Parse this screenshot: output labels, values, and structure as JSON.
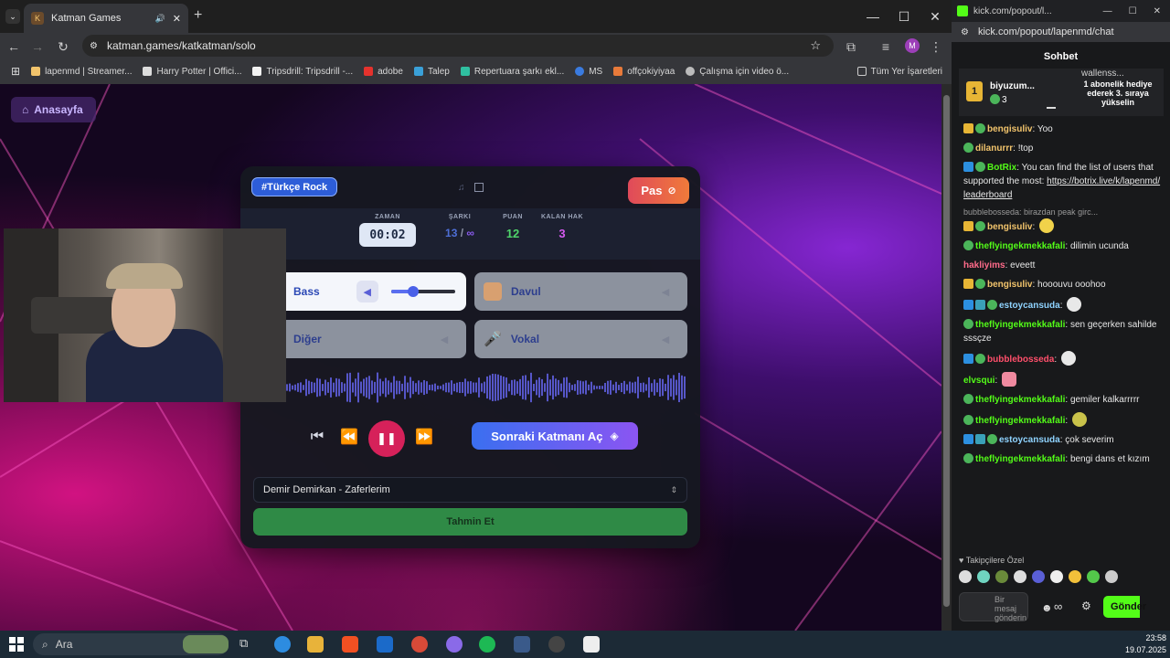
{
  "browser": {
    "tab_title": "Katman Games",
    "url": "katman.games/katkatman/solo",
    "bookmarks": [
      "lapenmd | Streamer...",
      "Harry Potter | Offici...",
      "Tripsdrill: Tripsdrill -...",
      "adobe",
      "Talep",
      "Repertuara şarkı ekl...",
      "MS",
      "offçokiyiyaa",
      "Çalışma için video ö..."
    ],
    "all_bookmarks": "Tüm Yer İşaretleri"
  },
  "page": {
    "home_label": "Anasayfa",
    "genre_tag": "#Türkçe Rock",
    "pass_label": "Pas",
    "stats": {
      "time_label": "ZAMAN",
      "time_value": "00:02",
      "song_label": "ŞARKI",
      "song_current": "13",
      "song_sep": "/",
      "song_total": "∞",
      "score_label": "PUAN",
      "score_value": "12",
      "lives_label": "KALAN HAK",
      "lives_value": "3"
    },
    "layers": [
      {
        "label": "Bass",
        "volume": 0.35
      },
      {
        "label": "Davul"
      },
      {
        "label": "Diğer"
      },
      {
        "label": "Vokal"
      }
    ],
    "next_layer_label": "Sonraki Katmanı Aç",
    "selected_song": "Demir Demirkan - Zaferlerim",
    "guess_label": "Tahmin Et"
  },
  "chat": {
    "window_title": "kick.com/popout/l...",
    "url": "kick.com/popout/lapenmd/chat",
    "header": "Sohbet",
    "pinned": {
      "user": "biyuzum...",
      "count": "3",
      "user2": "wallenss...",
      "text": "1 abonelik hediye ederek 3. sıraya yükselin"
    },
    "messages": [
      {
        "user": "bengisuliv",
        "color": "#f2c46c",
        "text": "Yoo"
      },
      {
        "user": "dilanurrr",
        "color": "#f2c46c",
        "text": "!top"
      },
      {
        "user": "BotRix",
        "color": "#53fc18",
        "text": "You can find the list of users that supported the most:",
        "link": "https://botrix.live/k/lapenmd/leaderboard"
      },
      {
        "reply": "bubblebosseda: birazdan peak girc...",
        "user": "bengisuliv",
        "color": "#f2c46c",
        "text": ""
      },
      {
        "user": "theflyingekmekkafali",
        "color": "#53fc18",
        "text": "dilimin ucunda"
      },
      {
        "user": "hakliyims",
        "color": "#ff6b8a",
        "text": "eveett"
      },
      {
        "user": "bengisuliv",
        "color": "#f2c46c",
        "text": "hooouvu ooohoo"
      },
      {
        "user": "estoycansuda",
        "color": "#8fd3ff",
        "text": ""
      },
      {
        "user": "theflyingekmekkafali",
        "color": "#53fc18",
        "text": "sen geçerken sahilde sssçze"
      },
      {
        "user": "bubblebosseda",
        "color": "#ff4f6b",
        "text": ""
      },
      {
        "user": "elvsqui",
        "color": "#53fc18",
        "text": ""
      },
      {
        "user": "theflyingekmekkafali",
        "color": "#53fc18",
        "text": "gemiler kalkarrrrr"
      },
      {
        "user": "theflyingekmekkafali",
        "color": "#53fc18",
        "text": ""
      },
      {
        "user": "estoycansuda",
        "color": "#8fd3ff",
        "text": "çok severim"
      },
      {
        "user": "theflyingekmekkafali",
        "color": "#53fc18",
        "text": "bengi dans et kızım"
      }
    ],
    "emotes_label": "Takipçilere Özel",
    "input_placeholder": "Bir mesaj gönderin",
    "send_label": "Gönder"
  },
  "taskbar": {
    "search_placeholder": "Ara",
    "time": "23:58",
    "date": "19.07.2025"
  }
}
